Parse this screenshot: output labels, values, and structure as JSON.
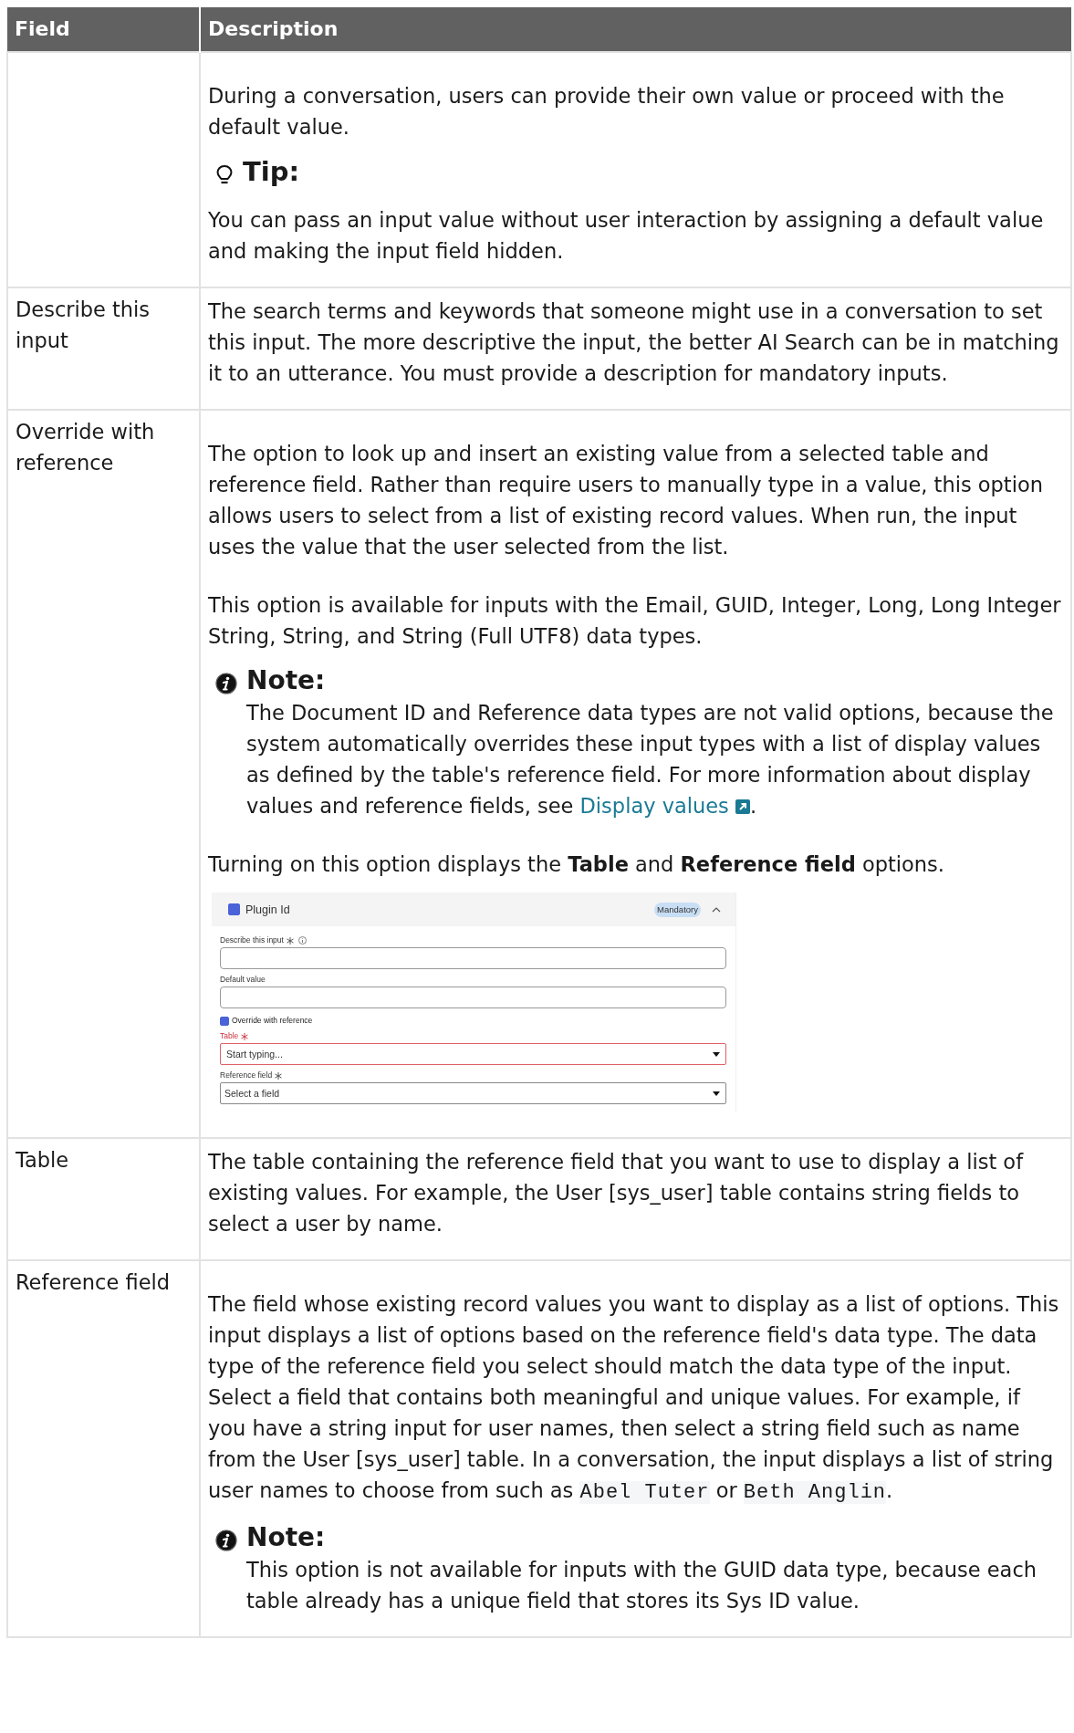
{
  "table": {
    "columns": [
      "Field",
      "Description"
    ],
    "rows": [
      {
        "field": "",
        "blocks": [
          {
            "kind": "para",
            "parts": [
              {
                "kind": "text",
                "text": "During a conversation, users can provide their own value or proceed with the default value."
              }
            ]
          },
          {
            "kind": "tip",
            "title": "Tip:",
            "parts": [
              {
                "kind": "text",
                "text": "You can pass an input value without user interaction by assigning a default value and making the input field hidden."
              }
            ]
          }
        ]
      },
      {
        "field": "Describe this input",
        "blocks": [
          {
            "kind": "para",
            "parts": [
              {
                "kind": "text",
                "text": "The search terms and keywords that someone might use in a conversation to set this input. The more descriptive the input, the better AI Search can be in matching it to an utterance. You must provide a description for mandatory inputs."
              }
            ]
          }
        ]
      },
      {
        "field": "Override with reference",
        "blocks": [
          {
            "kind": "para",
            "parts": [
              {
                "kind": "text",
                "text": "The option to look up and insert an existing value from a selected table and reference field. Rather than require users to manually type in a value, this option allows users to select from a list of existing record values. When run, the input uses the value that the user selected from the list."
              }
            ]
          },
          {
            "kind": "para",
            "parts": [
              {
                "kind": "text",
                "text": "This option is available for inputs with the Email, GUID, Integer, Long, Long Integer String, String, and String (Full UTF8) data types."
              }
            ]
          },
          {
            "kind": "note",
            "title": "Note:",
            "parts": [
              {
                "kind": "text",
                "text": "The Document ID and Reference data types are not valid options, because the system automatically overrides these input types with a list of display values as defined by the table's reference field. For more information about display values and reference fields, see "
              },
              {
                "kind": "link",
                "text": "Display values"
              },
              {
                "kind": "text",
                "text": "."
              }
            ]
          },
          {
            "kind": "para",
            "parts": [
              {
                "kind": "text",
                "text": "Turning on this option displays the **Table** and **Reference field** options."
              }
            ]
          },
          {
            "kind": "form",
            "title": "Plugin Id",
            "checked": true,
            "badge": "Mandatory",
            "expanded": true,
            "items": [
              {
                "kind": "input",
                "label": "Describe this input",
                "required": true,
                "info": true
              },
              {
                "kind": "input",
                "label": "Default value",
                "required": false,
                "info": false
              },
              {
                "kind": "checkbox",
                "label": "Override with reference",
                "checked": true
              },
              {
                "kind": "select",
                "label": "Table",
                "required": true,
                "error": true,
                "placeholder": "Start typing..."
              },
              {
                "kind": "select",
                "label": "Reference field",
                "required": true,
                "error": false,
                "value": "Select a field"
              }
            ]
          }
        ]
      },
      {
        "field": "Table",
        "blocks": [
          {
            "kind": "para",
            "parts": [
              {
                "kind": "text",
                "text": "The table containing the reference field that you want to use to display a list of existing values. For example, the User [sys_user] table contains string fields to select a user by name."
              }
            ]
          }
        ]
      },
      {
        "field": "Reference field",
        "blocks": [
          {
            "kind": "para",
            "parts": [
              {
                "kind": "text",
                "text": "The field whose existing record values you want to display as a list of options. This input displays a list of options based on the reference field's data type. The data type of the reference field you select should match the data type of the input. Select a field that contains both meaningful and unique values. For example, if you have a string input for user names, then select a string field such as name from the User [sys_user] table. In a conversation, the input displays a list of string user names to choose from such as "
              },
              {
                "kind": "code",
                "text": "Abel Tuter"
              },
              {
                "kind": "text",
                "text": " or "
              },
              {
                "kind": "code",
                "text": "Beth Anglin"
              },
              {
                "kind": "text",
                "text": "."
              }
            ]
          },
          {
            "kind": "note",
            "title": "Note:",
            "parts": [
              {
                "kind": "text",
                "text": "This option is not available for inputs with the GUID data type, because each table already has a unique field that stores its Sys ID value."
              }
            ]
          }
        ]
      }
    ]
  }
}
